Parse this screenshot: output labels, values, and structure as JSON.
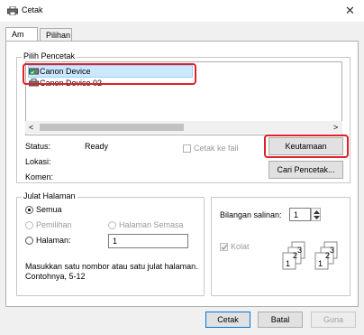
{
  "window": {
    "title": "Cetak",
    "close_glyph": "✕"
  },
  "tabs": [
    {
      "label": "Am"
    },
    {
      "label": "Pilihan"
    }
  ],
  "printer_group": {
    "legend": "Pilih Pencetak",
    "printers": [
      {
        "name": "Canon Device",
        "selected": true
      },
      {
        "name": "Canon Device 02",
        "selected": false
      }
    ]
  },
  "scrollbar": {
    "left": "<",
    "right": ">"
  },
  "status": {
    "status_label": "Status:",
    "status_value": "Ready",
    "location_label": "Lokasi:",
    "location_value": "",
    "comment_label": "Komen:",
    "comment_value": ""
  },
  "print_to_file": {
    "label": "Cetak ke fail",
    "checked": false
  },
  "buttons": {
    "preferences": "Keutamaan",
    "find_printer": "Cari Pencetak...",
    "print": "Cetak",
    "cancel": "Batal",
    "apply": "Guna"
  },
  "page_range": {
    "legend": "Julat Halaman",
    "all": "Semua",
    "selection": "Pemilihan",
    "current_page": "Halaman Semasa",
    "pages": "Halaman:",
    "pages_value": "1",
    "hint": "Masukkan satu nombor atau satu julat halaman. Contohnya, 5-12",
    "selected_option": "Semua"
  },
  "copies": {
    "label": "Bilangan salinan:",
    "value": "1",
    "collate_label": "Kolat",
    "collate_checked": true
  },
  "colors": {
    "highlight_red": "#e0202a",
    "selection_blue": "#cce8ff",
    "accent": "#0078d7"
  },
  "icons": {
    "window": "printer-icon",
    "selected_printer": "printer-check-icon",
    "printer": "printer-icon"
  }
}
